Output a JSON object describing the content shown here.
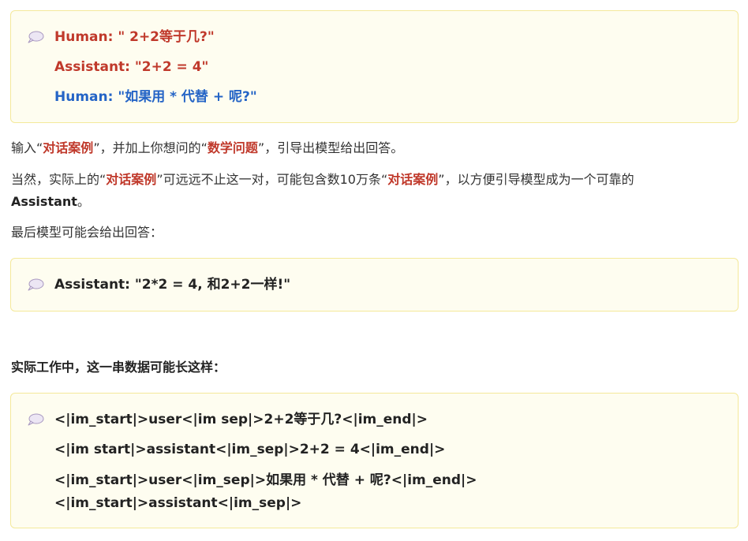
{
  "callout1": {
    "lines": [
      "Human: \" 2+2等于几?\"",
      "Assistant: \"2+2 = 4\"",
      "Human: \"如果用 * 代替 + 呢?\""
    ]
  },
  "para1": {
    "t1": "输入“",
    "h1": "对话案例",
    "t2": "”，并加上你想问的“",
    "h2": "数学问题",
    "t3": "”，引导出模型给出回答。"
  },
  "para2": {
    "t1": "当然，实际上的“",
    "h1": "对话案例",
    "t2": "”可远远不止这一对，可能包含数10万条“",
    "h2": "对话案例",
    "t3": "”，以方便引导模型成为一个可靠的",
    "t4": "Assistant",
    "t5": "。"
  },
  "para3": {
    "text": "最后模型可能会给出回答："
  },
  "callout2": {
    "line": "Assistant: \"2*2 = 4, 和2+2一样!\""
  },
  "heading": {
    "text": "实际工作中，这一串数据可能长这样："
  },
  "callout3": {
    "lines": [
      "<|im_start|>user<|im sep|>2+2等于几?<|im_end|>",
      "<|im start|>assistant<|im_sep|>2+2 = 4<|im_end|>",
      "<|im_start|>user<|im_sep|>如果用 * 代替 + 呢?<|im_end|>",
      "<|im_start|>assistant<|im_sep|>"
    ]
  },
  "icons": {
    "callout": "speech-bubble-icon"
  },
  "colors": {
    "callout_bg": "#fefdf0",
    "callout_border": "#f4e99a",
    "red": "#c0392b",
    "blue": "#2464c6"
  }
}
